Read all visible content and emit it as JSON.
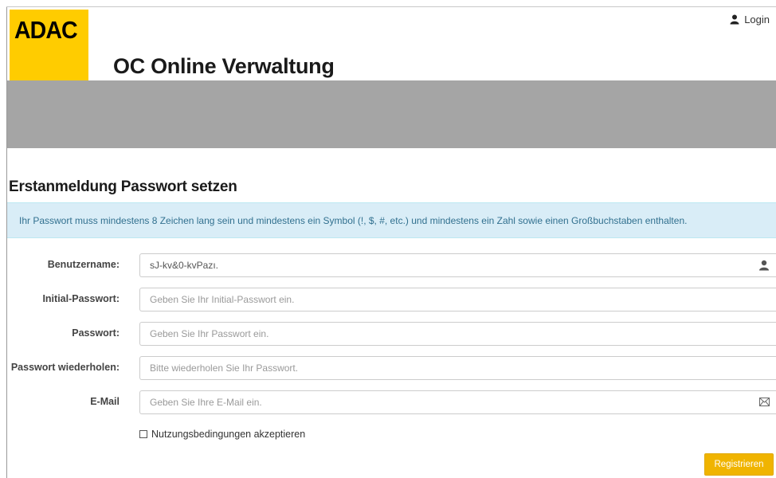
{
  "header": {
    "logo_text": "ADAC",
    "app_title": "OC Online Verwaltung",
    "login_label": "Login",
    "brand_color": "#ffcc00"
  },
  "form": {
    "heading": "Erstanmeldung Passwort setzen",
    "info_text": "Ihr Passwort muss mindestens 8 Zeichen lang sein und mindestens ein Symbol (!, $, #, etc.) und mindestens ein Zahl sowie einen Großbuchstaben enthalten.",
    "fields": [
      {
        "label": "Benutzername:",
        "value": "sJ-kv&0-kvPazı.",
        "placeholder": "",
        "icon": "user-icon"
      },
      {
        "label": "Initial-Passwort:",
        "value": "",
        "placeholder": "Geben Sie Ihr Initial-Passwort ein.",
        "icon": ""
      },
      {
        "label": "Passwort:",
        "value": "",
        "placeholder": "Geben Sie Ihr Passwort ein.",
        "icon": ""
      },
      {
        "label": "Passwort wiederholen:",
        "value": "",
        "placeholder": "Bitte wiederholen Sie Ihr Passwort.",
        "icon": ""
      },
      {
        "label": "E-Mail",
        "value": "",
        "placeholder": "Geben Sie Ihre E-Mail ein.",
        "icon": "envelope-icon"
      }
    ],
    "terms_label": "Nutzungsbedingungen akzeptieren",
    "terms_checked": false,
    "submit_label": "Registrieren",
    "submit_color": "#f0b400"
  }
}
